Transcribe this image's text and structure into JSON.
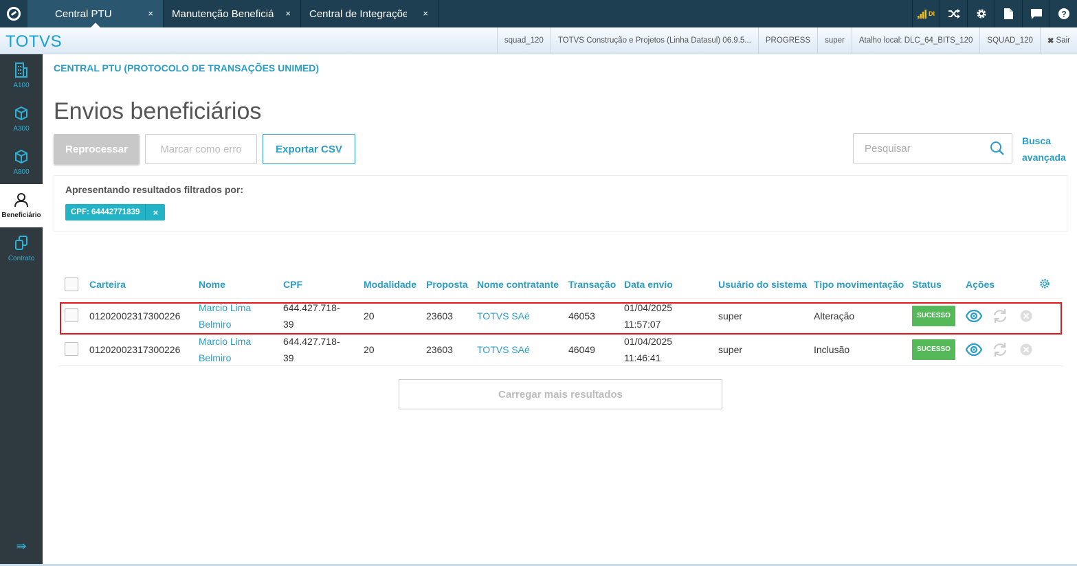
{
  "tabs": [
    {
      "label": "Central PTU",
      "close": "×"
    },
    {
      "label": "Manutenção Beneficiá",
      "close": "×"
    },
    {
      "label": "Central de Integrações",
      "close": "×"
    }
  ],
  "top_icons": [
    "signal-bars-icon",
    "shuffle-icon",
    "gear-icon",
    "document-icon",
    "chat-icon",
    "help-icon"
  ],
  "top_icon_signal_text": "DI",
  "brand": "TOTVS",
  "header_info": {
    "squad": "squad_120",
    "product": "TOTVS Construção e Projetos (Linha Datasul) 06.9.5...",
    "db": "PROGRESS",
    "user": "super",
    "shortcut": "Atalho local: DLC_64_BITS_120",
    "squad_upper": "SQUAD_120",
    "exit": "Sair"
  },
  "sidebar": {
    "items": [
      {
        "label": "A100",
        "icon": "building-icon"
      },
      {
        "label": "A300",
        "icon": "cube-icon"
      },
      {
        "label": "A800",
        "icon": "cube-icon"
      },
      {
        "label": "Beneficiário",
        "icon": "user-icon"
      },
      {
        "label": "Contrato",
        "icon": "copy-icon"
      }
    ],
    "collapse": "⇛"
  },
  "breadcrumb": "CENTRAL PTU (PROTOCOLO DE TRANSAÇÕES UNIMED)",
  "page_title": "Envios beneficiários",
  "actions": {
    "reprocess": "Reprocessar",
    "mark_error": "Marcar como erro",
    "export_csv": "Exportar CSV"
  },
  "search": {
    "placeholder": "Pesquisar",
    "advanced_line1": "Busca",
    "advanced_line2": "avançada"
  },
  "filters": {
    "title": "Apresentando resultados filtrados por:",
    "chips": [
      {
        "label": "CPF: 64442771839",
        "remove": "×"
      }
    ]
  },
  "table": {
    "columns": [
      "Carteira",
      "Nome",
      "CPF",
      "Modalidade",
      "Proposta",
      "Nome contratante",
      "Transação",
      "Data envio",
      "Usuário do sistema",
      "Tipo movimentação",
      "Status",
      "Ações"
    ],
    "rows": [
      {
        "carteira": "01202002317300226",
        "nome_1": "Marcio Lima",
        "nome_2": "Belmiro",
        "cpf_1": "644.427.718-",
        "cpf_2": "39",
        "modalidade": "20",
        "proposta": "23603",
        "contratante": "TOTVS SAé",
        "transacao": "46053",
        "data_1": "01/04/2025",
        "data_2": "11:57:07",
        "usuario": "super",
        "tipo": "Alteração",
        "status": "SUCESSO"
      },
      {
        "carteira": "01202002317300226",
        "nome_1": "Marcio Lima",
        "nome_2": "Belmiro",
        "cpf_1": "644.427.718-",
        "cpf_2": "39",
        "modalidade": "20",
        "proposta": "23603",
        "contratante": "TOTVS SAé",
        "transacao": "46049",
        "data_1": "01/04/2025",
        "data_2": "11:46:41",
        "usuario": "super",
        "tipo": "Inclusão",
        "status": "SUCESSO"
      }
    ]
  },
  "load_more": "Carregar mais resultados",
  "colors": {
    "topbar": "#1e3f52",
    "accent": "#2a9dc7",
    "success": "#55b95a",
    "sidebar": "#2e3a40",
    "highlight": "#e3161b"
  }
}
